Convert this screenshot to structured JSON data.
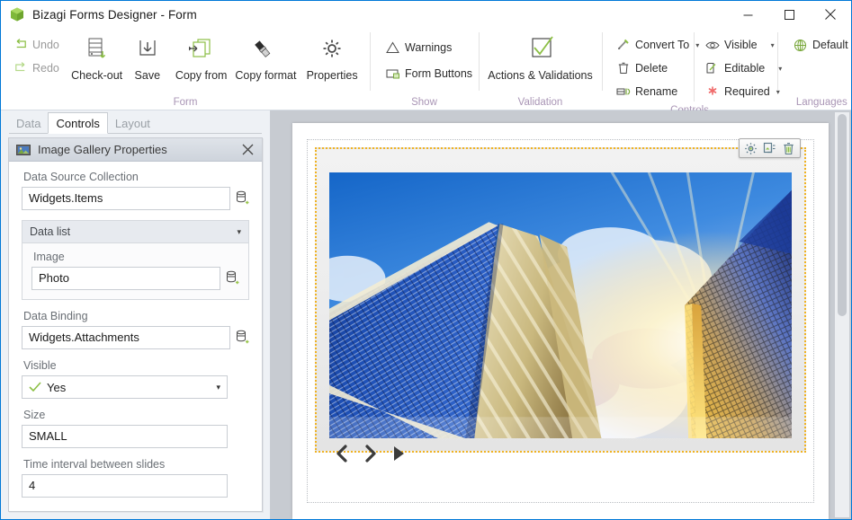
{
  "window": {
    "title": "Bizagi Forms Designer  - Form",
    "logo_icon": "bizagi-cube-icon",
    "controls": [
      {
        "name": "minimize",
        "icon": "minimize-icon"
      },
      {
        "name": "maximize",
        "icon": "maximize-icon"
      },
      {
        "name": "close",
        "icon": "close-icon"
      }
    ]
  },
  "ribbon": {
    "groups": [
      {
        "label": "Form",
        "small_items": [
          {
            "label": "Undo",
            "icon": "undo-icon",
            "disabled": true
          },
          {
            "label": "Redo",
            "icon": "redo-icon",
            "disabled": true
          }
        ],
        "big_items": [
          {
            "label": "Check-out",
            "icon": "check-out-icon"
          },
          {
            "label": "Save",
            "icon": "save-icon"
          },
          {
            "label": "Copy from",
            "icon": "copy-from-icon"
          },
          {
            "label": "Copy format",
            "icon": "copy-format-icon"
          },
          {
            "label": "Properties",
            "icon": "gear-icon"
          }
        ]
      },
      {
        "label": "Show",
        "small_items": [
          {
            "label": "Warnings",
            "icon": "warning-triangle-icon"
          },
          {
            "label": "Form Buttons",
            "icon": "form-buttons-icon"
          }
        ]
      },
      {
        "label": "Validation",
        "big_items": [
          {
            "label": "Actions & Validations",
            "icon": "checkmark-box-icon"
          }
        ]
      },
      {
        "label": "Controls",
        "small_items": [
          {
            "label": "Convert To",
            "icon": "convert-to-icon",
            "caret": true
          },
          {
            "label": "Delete",
            "icon": "trash-icon"
          },
          {
            "label": "Rename",
            "icon": "rename-icon"
          }
        ],
        "small_items2": [
          {
            "label": "Visible",
            "icon": "eye-icon",
            "caret": true
          },
          {
            "label": "Editable",
            "icon": "editable-page-icon",
            "caret": true
          },
          {
            "label": "Required",
            "icon": "asterisk-icon",
            "caret": true
          }
        ]
      },
      {
        "label": "Languages",
        "small_items": [
          {
            "label": "Default",
            "icon": "globe-icon",
            "caret": true
          }
        ]
      }
    ]
  },
  "sidebar": {
    "tabs": [
      {
        "label": "Data",
        "active": false
      },
      {
        "label": "Controls",
        "active": true
      },
      {
        "label": "Layout",
        "active": false
      }
    ],
    "panel": {
      "icon": "image-gallery-icon",
      "title": "Image Gallery Properties",
      "close_icon": "close-icon",
      "fields": [
        {
          "label": "Data Source Collection",
          "value": "Widgets.Items",
          "icon": "data-binding-icon"
        }
      ],
      "group": {
        "title": "Data list",
        "caret": "▾",
        "fields": [
          {
            "label": "Image",
            "value": "Photo",
            "icon": "data-binding-icon"
          }
        ]
      },
      "fields_after": [
        {
          "label": "Data Binding",
          "value": "Widgets.Attachments",
          "icon": "data-binding-icon"
        }
      ],
      "visible": {
        "label": "Visible",
        "value": "Yes",
        "check_icon": "check-icon",
        "caret": "▾"
      },
      "size": {
        "label": "Size",
        "value": "SMALL"
      },
      "interval": {
        "label": "Time interval between slides",
        "value": "4"
      }
    }
  },
  "canvas": {
    "widget": {
      "name": "image-gallery-widget",
      "selection_color": "#f0b323",
      "toolbar": [
        {
          "name": "widget-settings",
          "icon": "gear-icon"
        },
        {
          "name": "widget-duplicate",
          "icon": "duplicate-icon"
        },
        {
          "name": "widget-delete",
          "icon": "trash-icon"
        }
      ],
      "image_alt": "skyscrapers-blue-sky-sun-flare-photo",
      "nav": [
        {
          "name": "previous-slide",
          "icon": "chevron-left-icon"
        },
        {
          "name": "next-slide",
          "icon": "chevron-right-icon"
        },
        {
          "name": "play-slideshow",
          "icon": "play-icon"
        }
      ]
    }
  }
}
